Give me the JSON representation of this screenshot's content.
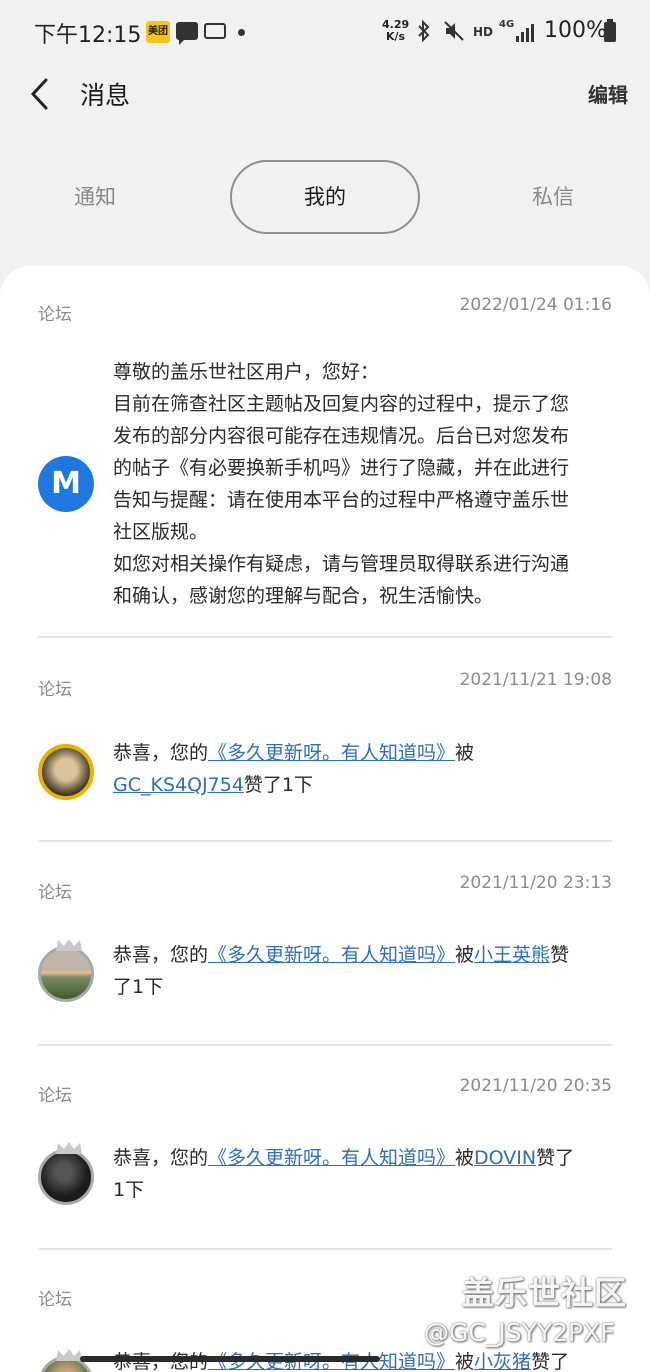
{
  "status_bar": {
    "time": "下午12:15",
    "meituan_icon": "美团",
    "speed_value": "4.29",
    "speed_unit": "K/s",
    "hd": "HD",
    "network": "4G",
    "battery": "100%"
  },
  "header": {
    "title": "消息",
    "edit_label": "编辑"
  },
  "tabs": [
    {
      "label": "通知"
    },
    {
      "label": "我的"
    },
    {
      "label": "私信"
    }
  ],
  "active_tab": "我的",
  "messages": [
    {
      "category": "论坛",
      "time": "2022/01/24 01:16",
      "avatar_letter": "M",
      "lines": [
        "尊敬的盖乐世社区用户，您好：",
        "目前在筛查社区主题帖及回复内容的过程中，提示了您",
        "发布的部分内容很可能存在违规情况。后台已对您发布",
        "的帖子《有必要换新手机吗》进行了隐藏，并在此进行",
        "告知与提醒：请在使用本平台的过程中严格遵守盖乐世",
        "社区版规。",
        "如您对相关操作有疑虑，请与管理员取得联系进行沟通",
        "和确认，感谢您的理解与配合，祝生活愉快。"
      ]
    },
    {
      "category": "论坛",
      "time": "2021/11/21 19:08",
      "prefix": "恭喜，您的",
      "post_link": "《多久更新呀。有人知道吗》",
      "mid": "被",
      "user_link": "GC_KS4QJ754",
      "suffix": "赞了1下"
    },
    {
      "category": "论坛",
      "time": "2021/11/20 23:13",
      "prefix": "恭喜，您的",
      "post_link": "《多久更新呀。有人知道吗》",
      "mid": "被",
      "user_link": "小王英熊",
      "suffix": "赞",
      "suffix2": "了1下"
    },
    {
      "category": "论坛",
      "time": "2021/11/20 20:35",
      "prefix": "恭喜，您的",
      "post_link": "《多久更新呀。有人知道吗》",
      "mid": "被",
      "user_link": "DOVIN",
      "suffix": "赞了",
      "suffix2": "1下"
    },
    {
      "category": "论坛",
      "prefix": "恭喜，您的",
      "post_link": "《多久更新呀。有人知道吗》",
      "mid": "被",
      "user_link": "小灰猪",
      "suffix": "赞了"
    }
  ],
  "watermark": {
    "title": "盖乐世社区",
    "handle": "@GC_JSYY2PXF"
  },
  "colors": {
    "link": "#2f6fb5",
    "background": "#f1f1f1",
    "card": "#ffffff",
    "m_avatar": "#1f77e0"
  }
}
